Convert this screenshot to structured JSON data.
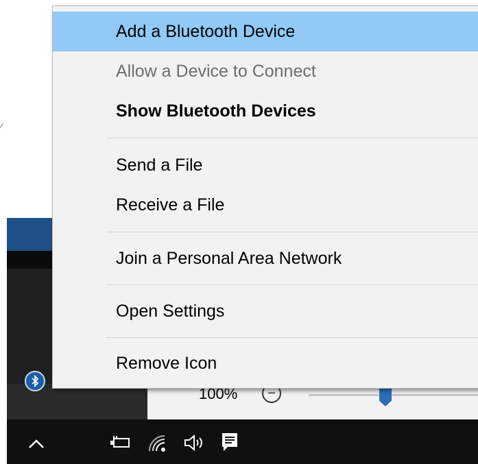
{
  "context_menu": {
    "items": [
      {
        "label": "Add a Bluetooth Device",
        "state": "highlighted"
      },
      {
        "label": "Allow a Device to Connect",
        "state": "disabled"
      },
      {
        "label": "Show Bluetooth Devices",
        "state": "default-bold"
      },
      {
        "label": "Send a File"
      },
      {
        "label": "Receive a File"
      },
      {
        "label": "Join a Personal Area Network"
      },
      {
        "label": "Open Settings"
      },
      {
        "label": "Remove Icon"
      }
    ]
  },
  "settings_panel": {
    "zoom_label": "100%",
    "zoom_minus": "−"
  },
  "taskbar": {
    "icons": [
      "chevron-up-icon",
      "power-icon",
      "wifi-icon",
      "volume-icon",
      "action-center-icon"
    ]
  },
  "colors": {
    "highlight": "#91c9f7",
    "menu_bg": "#f2f2f2",
    "disabled_text": "#6d6d6d",
    "taskbar": "#101010",
    "accent_blue": "#2a6fb7"
  }
}
